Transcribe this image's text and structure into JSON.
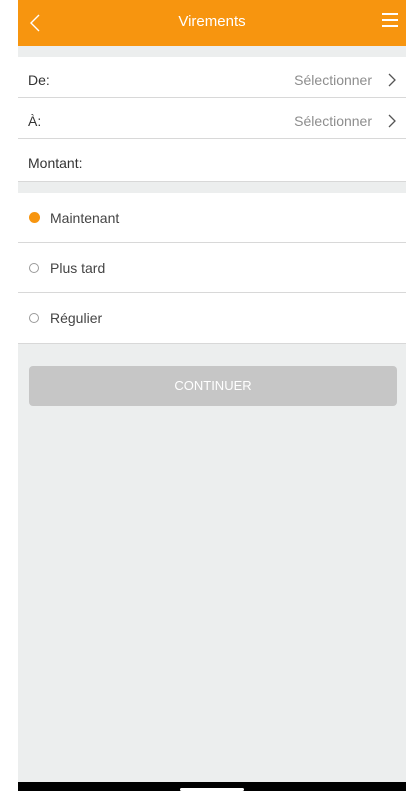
{
  "header": {
    "title": "Virements",
    "back_icon": "chevron-left-icon",
    "menu_icon": "hamburger-menu-icon",
    "color": "#f7950f"
  },
  "form": {
    "from": {
      "label": "De:",
      "value": "Sélectionner"
    },
    "to": {
      "label": "À:",
      "value": "Sélectionner"
    },
    "amount": {
      "label": "Montant:"
    }
  },
  "timing": {
    "options": [
      {
        "label": "Maintenant",
        "selected": true
      },
      {
        "label": "Plus tard",
        "selected": false
      },
      {
        "label": "Régulier",
        "selected": false
      }
    ]
  },
  "actions": {
    "continue_label": "CONTINUER",
    "continue_enabled": false
  }
}
